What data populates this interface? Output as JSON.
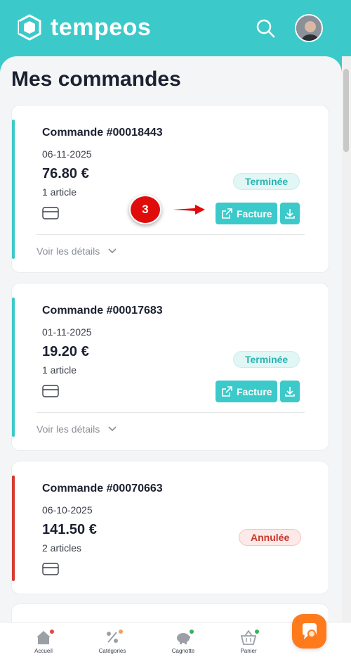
{
  "app": {
    "name": "tempeos"
  },
  "page": {
    "title": "Mes commandes"
  },
  "orders": [
    {
      "title": "Commande #00018443",
      "date": "06-11-2025",
      "price": "76.80 €",
      "items": "1 article",
      "status": "Terminée",
      "invoice_label": "Facture",
      "details_label": "Voir les détails"
    },
    {
      "title": "Commande #00017683",
      "date": "01-11-2025",
      "price": "19.20 €",
      "items": "1 article",
      "status": "Terminée",
      "invoice_label": "Facture",
      "details_label": "Voir les détails"
    },
    {
      "title": "Commande #00070663",
      "date": "06-10-2025",
      "price": "141.50 €",
      "items": "2 articles",
      "status": "Annulée"
    }
  ],
  "annotation": {
    "step": "3"
  },
  "nav": [
    {
      "label": "Accueil",
      "icon": "home-icon"
    },
    {
      "label": "Catégories",
      "icon": "percent-tag-icon"
    },
    {
      "label": "Cagnotte",
      "icon": "piggy-bank-icon"
    },
    {
      "label": "Panier",
      "icon": "basket-icon"
    }
  ],
  "colors": {
    "brand": "#3cc9c9",
    "done": "#2bb3b0",
    "cancel": "#c6382c",
    "accent_orange": "#ff7a1a",
    "annotation_red": "#e00b0b"
  }
}
